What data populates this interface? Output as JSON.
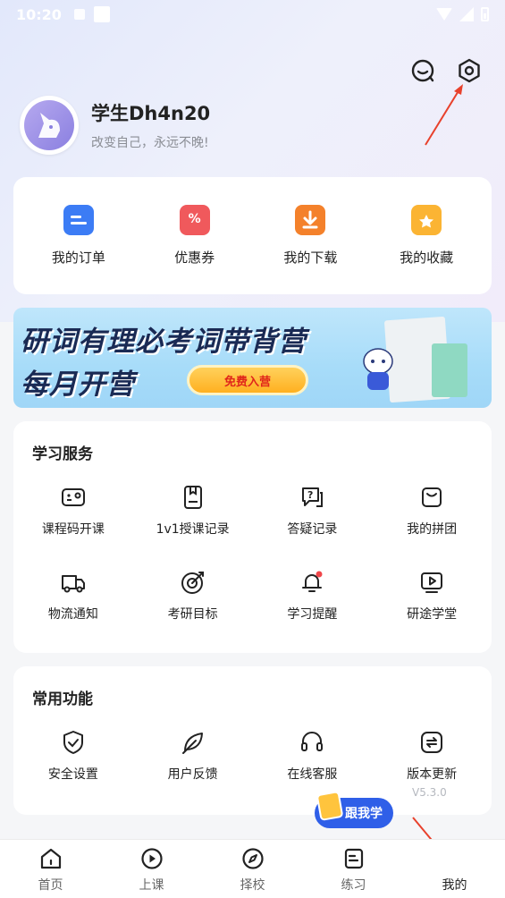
{
  "status_bar": {
    "time": "10:20"
  },
  "profile": {
    "username": "学生Dh4n20",
    "motto": "改变自己，永远不晚!"
  },
  "quick_actions": [
    {
      "label": "我的订单",
      "icon": "order-icon"
    },
    {
      "label": "优惠券",
      "icon": "coupon-icon"
    },
    {
      "label": "我的下载",
      "icon": "download-icon"
    },
    {
      "label": "我的收藏",
      "icon": "favorite-folder-icon"
    }
  ],
  "banner": {
    "line1": "研词有理必考词带背营",
    "line2": "每月开营",
    "button": "免费入营"
  },
  "study_services": {
    "title": "学习服务",
    "items": [
      {
        "label": "课程码开课",
        "icon": "course-code-icon"
      },
      {
        "label": "1v1授课记录",
        "icon": "tutoring-record-icon"
      },
      {
        "label": "答疑记录",
        "icon": "qa-record-icon"
      },
      {
        "label": "我的拼团",
        "icon": "group-buy-icon"
      },
      {
        "label": "物流通知",
        "icon": "delivery-truck-icon"
      },
      {
        "label": "考研目标",
        "icon": "target-icon"
      },
      {
        "label": "学习提醒",
        "icon": "bell-icon"
      },
      {
        "label": "研途学堂",
        "icon": "video-play-icon"
      }
    ]
  },
  "common_functions": {
    "title": "常用功能",
    "items": [
      {
        "label": "安全设置",
        "icon": "shield-icon"
      },
      {
        "label": "用户反馈",
        "icon": "feedback-leaf-icon"
      },
      {
        "label": "在线客服",
        "icon": "headset-icon"
      },
      {
        "label": "版本更新",
        "icon": "update-icon"
      }
    ],
    "version": "V5.3.0"
  },
  "floating_bubble": {
    "label": "跟我学"
  },
  "tabbar": [
    {
      "label": "首页",
      "icon": "home-icon"
    },
    {
      "label": "上课",
      "icon": "play-circle-icon"
    },
    {
      "label": "择校",
      "icon": "compass-icon"
    },
    {
      "label": "练习",
      "icon": "practice-doc-icon"
    },
    {
      "label": "我的",
      "icon": "me-icon",
      "active": true
    }
  ],
  "colors": {
    "accent": "#2f5fe8",
    "annotation_arrow": "#e8412c"
  }
}
